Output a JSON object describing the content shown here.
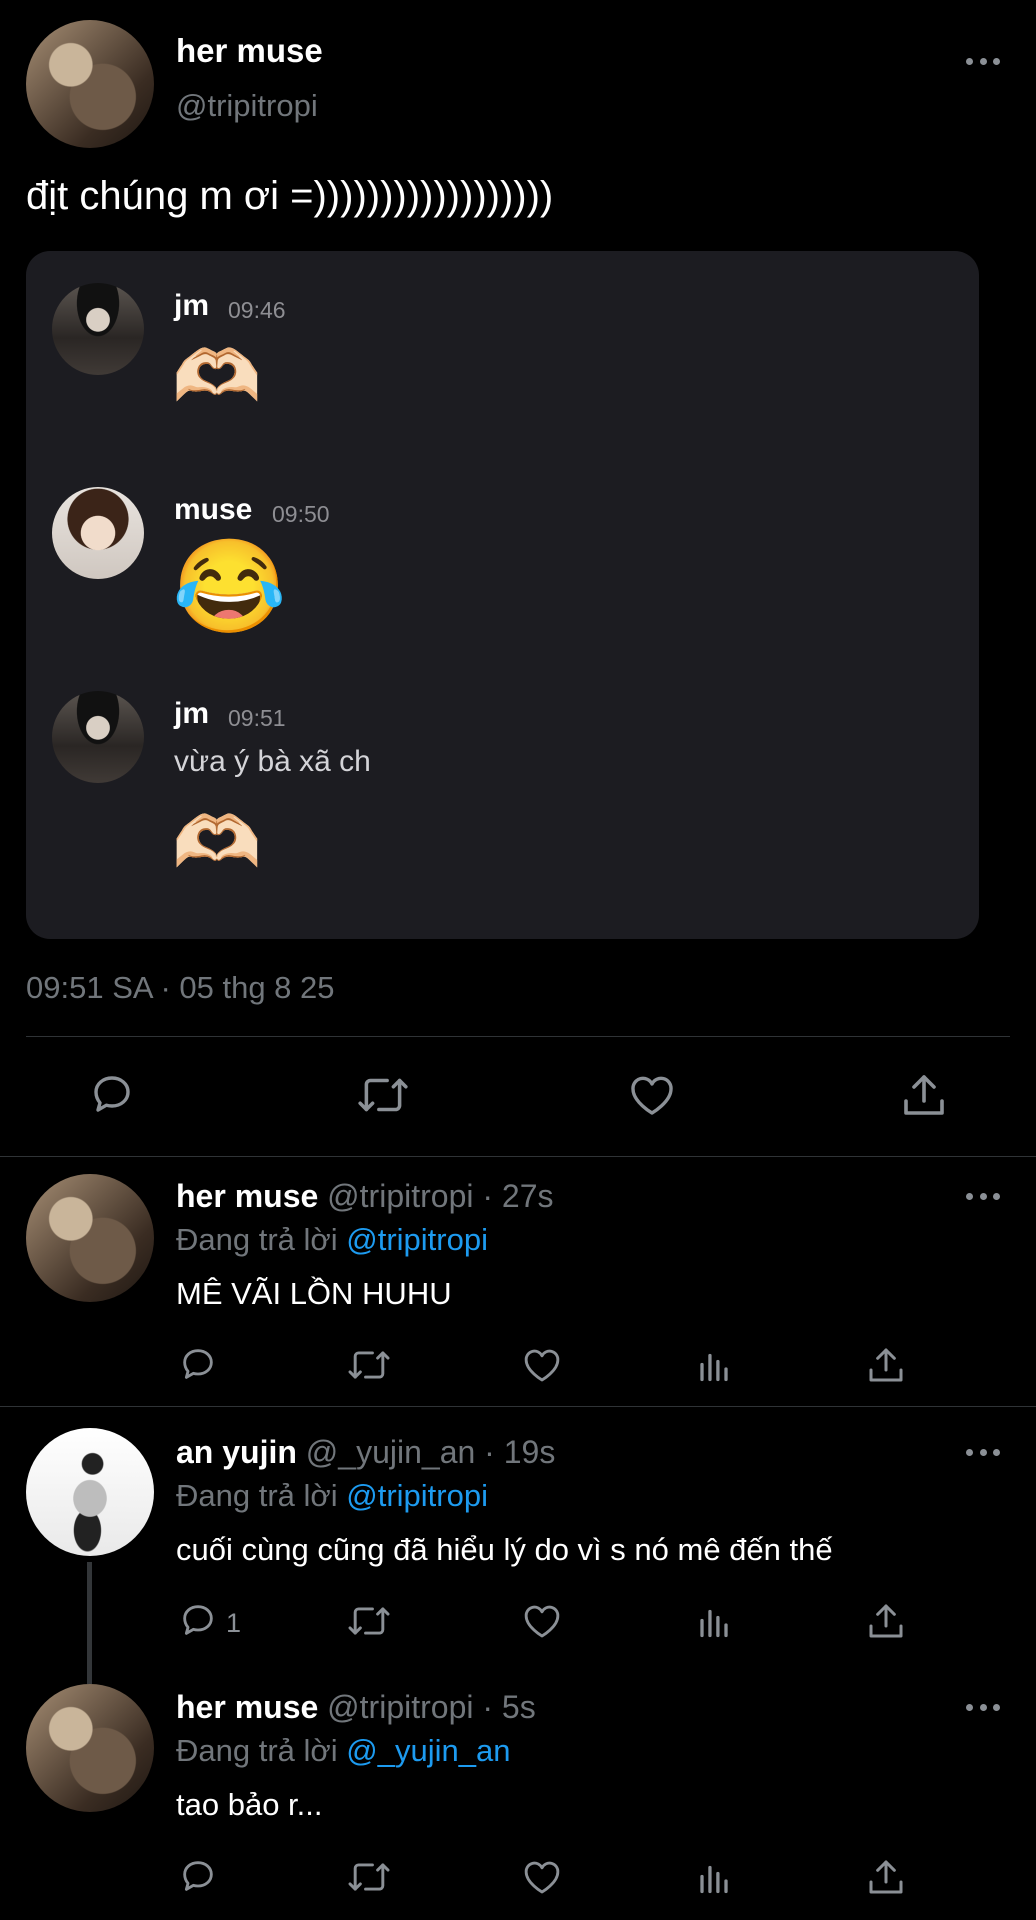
{
  "main_tweet": {
    "display_name": "her muse",
    "handle": "@tripitropi",
    "text": "địt chúng m ơi =))))))))))))))))))",
    "timestamp": "09:51 SA · 05 thg 8 25",
    "chat": [
      {
        "name": "jm",
        "time": "09:46",
        "text": "",
        "emoji": "🫶🏻"
      },
      {
        "name": "muse",
        "time": "09:50",
        "text": "",
        "emoji": "😂"
      },
      {
        "name": "jm",
        "time": "09:51",
        "text": "vừa ý bà xã ch",
        "emoji": "🫶🏻"
      }
    ]
  },
  "replies": [
    {
      "display_name": "her muse",
      "meta": "@tripitropi · 27s",
      "replying_label": "Đang trả lời",
      "replying_to": "@tripitropi",
      "text": "MÊ VÃI LỒN HUHU",
      "reply_count": ""
    },
    {
      "display_name": "an yujin",
      "meta": "@_yujin_an · 19s",
      "replying_label": "Đang trả lời",
      "replying_to": "@tripitropi",
      "text": "cuối cùng cũng đã hiểu lý do vì s nó mê đến thế",
      "reply_count": "1"
    },
    {
      "display_name": "her muse",
      "meta": "@tripitropi · 5s",
      "replying_label": "Đang trả lời",
      "replying_to": "@_yujin_an",
      "text": "tao bảo r...",
      "reply_count": ""
    }
  ],
  "colors": {
    "background": "#000000",
    "secondary_text": "#71767b",
    "link": "#1d9bf0",
    "card": "#1c1c21"
  }
}
